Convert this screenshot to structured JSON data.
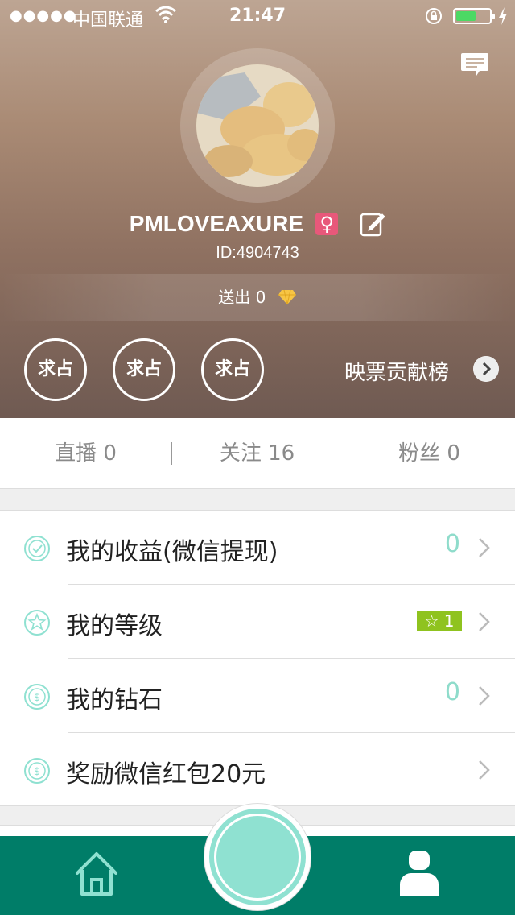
{
  "status_bar": {
    "signal": "●●●●●",
    "carrier": "中国联通",
    "time": "21:47",
    "battery_level": 0.55,
    "icons": [
      "wifi-icon",
      "rotation-lock-icon",
      "battery-icon",
      "charging-bolt-icon"
    ]
  },
  "profile": {
    "username": "PMLOVEAXURE",
    "gender_symbol": "♀",
    "id_text": "ID:4904743",
    "sent_text": "送出 0"
  },
  "contribution": {
    "badges": [
      "求占",
      "求占",
      "求占"
    ],
    "label": "映票贡献榜"
  },
  "stats": [
    {
      "label": "直播 0"
    },
    {
      "label": "关注 16"
    },
    {
      "label": "粉丝 0"
    }
  ],
  "menu": [
    {
      "label": "我的收益(微信提现)",
      "value": "0",
      "icon": "check-circle-icon"
    },
    {
      "label": "我的等级",
      "value": "1",
      "icon": "star-circle-icon"
    },
    {
      "label": "我的钻石",
      "value": "0",
      "icon": "coin-circle-icon"
    },
    {
      "label": "奖励微信红包20元",
      "value": "",
      "icon": "coin-circle-icon"
    }
  ],
  "level_badge_star": "☆",
  "colors": {
    "accent": "#8fe1d1",
    "tabbar": "#007d68",
    "level_badge": "#8fc31f",
    "gender_badge": "#e8587a"
  }
}
